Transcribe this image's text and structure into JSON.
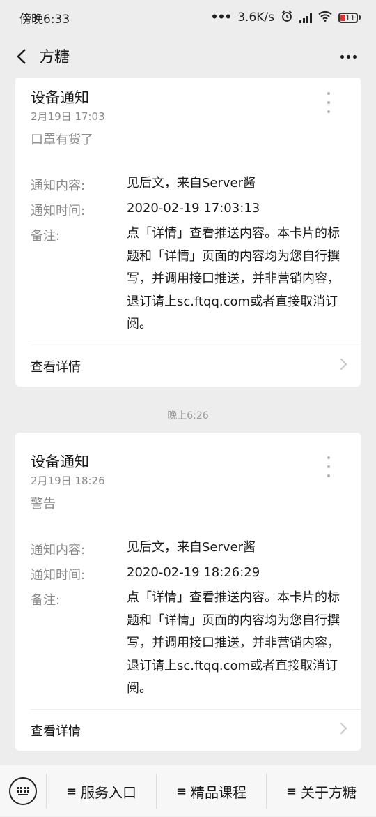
{
  "status_bar": {
    "time": "傍晚6:33",
    "speed": "3.6K/s",
    "battery": "11"
  },
  "nav": {
    "title": "方糖"
  },
  "cards": [
    {
      "title": "设备通知",
      "date": "2月19日  17:03",
      "subtitle": "口罩有货了",
      "rows": [
        {
          "label": "通知内容:",
          "value": "见后文，来自Server酱"
        },
        {
          "label": "通知时间:",
          "value": "2020-02-19 17:03:13"
        },
        {
          "label": "备注:",
          "value": "点「详情」查看推送内容。本卡片的标题和「详情」页面的内容均为您自行撰写，并调用接口推送，并非营销内容，退订请上sc.ftqq.com或者直接取消订阅。"
        }
      ],
      "detail_label": "查看详情"
    },
    {
      "title": "设备通知",
      "date": "2月19日  18:26",
      "subtitle": "警告",
      "rows": [
        {
          "label": "通知内容:",
          "value": "见后文，来自Server酱"
        },
        {
          "label": "通知时间:",
          "value": "2020-02-19 18:26:29"
        },
        {
          "label": "备注:",
          "value": "点「详情」查看推送内容。本卡片的标题和「详情」页面的内容均为您自行撰写，并调用接口推送，并非营销内容，退订请上sc.ftqq.com或者直接取消订阅。"
        }
      ],
      "detail_label": "查看详情"
    }
  ],
  "timestamp": "晚上6:26",
  "bottom_menu": [
    {
      "label": "服务入口",
      "icon": "≡"
    },
    {
      "label": "精品课程",
      "icon": "≡"
    },
    {
      "label": "关于方糖",
      "icon": "≡"
    }
  ]
}
